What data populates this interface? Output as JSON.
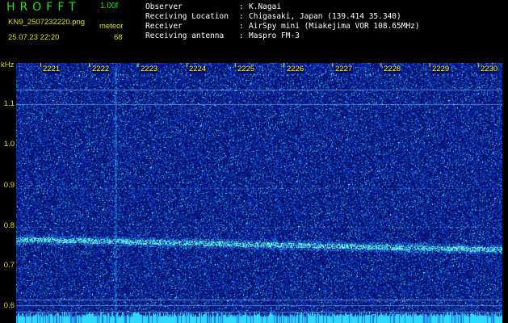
{
  "header": {
    "app_title": "HROFFT",
    "version": "1.00f",
    "filename": "KN9_2507232220.png",
    "datetime": "25.07.23 22:20",
    "meter_label": "meteor",
    "meter_value": "68"
  },
  "info": {
    "observer": {
      "label": "Observer",
      "sep": ":",
      "value": "K.Nagai"
    },
    "location": {
      "label": "Receiving Location",
      "sep": ":",
      "value": "Chigasaki, Japan (139.414 35.340)"
    },
    "receiver": {
      "label": "Receiver",
      "sep": ":",
      "value": "AirSpy mini (Miakejima VOR 108.65MHz)"
    },
    "antenna": {
      "label": "Receiving antenna",
      "sep": ":",
      "value": "Maspro FM-3"
    }
  },
  "axis": {
    "unit": "kHz",
    "time_ticks": [
      "2221",
      "2222",
      "2223",
      "2224",
      "2225",
      "2226",
      "2227",
      "2228",
      "2229",
      "2230"
    ],
    "freq_ticks": [
      "1.1",
      "1.0",
      "0.9",
      "0.8",
      "0.7",
      "0.6"
    ]
  },
  "colors": {
    "background": "#000000",
    "waterfall_base": "#06106a",
    "title_green": "#20e020",
    "label_yellow": "#e0e000",
    "info_white": "#ffffff",
    "signal_cyan": "#40e0ff"
  },
  "signal": {
    "carrier_start_khz": 0.768,
    "carrier_end_khz": 0.742
  }
}
